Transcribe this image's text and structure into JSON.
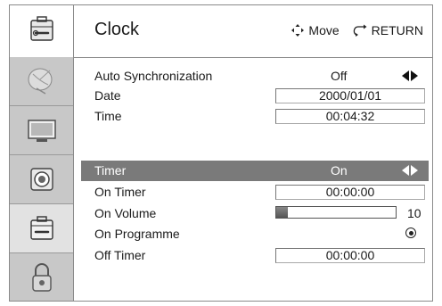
{
  "header": {
    "title": "Clock",
    "move_label": "Move",
    "return_label": "RETURN",
    "move_icon": "four-way-arrows-icon",
    "return_icon": "return-arrow-icon"
  },
  "sidebar": {
    "items": [
      {
        "name": "satellite-dish-icon"
      },
      {
        "name": "tv-screen-icon"
      },
      {
        "name": "speaker-icon"
      },
      {
        "name": "settings-toolbox-icon",
        "active": true
      },
      {
        "name": "lock-icon"
      }
    ]
  },
  "rows": {
    "auto_sync": {
      "label": "Auto Synchronization",
      "value": "Off"
    },
    "date": {
      "label": "Date",
      "value": "2000/01/01"
    },
    "time": {
      "label": "Time",
      "value": "00:04:32"
    },
    "timer": {
      "label": "Timer",
      "value": "On"
    },
    "on_timer": {
      "label": "On Timer",
      "value": "00:00:00"
    },
    "on_volume": {
      "label": "On Volume",
      "value": "10",
      "fill_fraction": 0.1
    },
    "on_programme": {
      "label": "On Programme"
    },
    "off_timer": {
      "label": "Off Timer",
      "value": "00:00:00"
    }
  },
  "colors": {
    "selected_row": "#7a7a7a",
    "sidebar": "#c8c8c8"
  }
}
